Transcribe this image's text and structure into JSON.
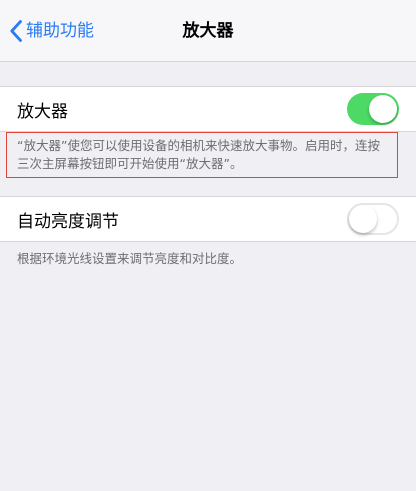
{
  "navbar": {
    "back_label": "辅助功能",
    "title": "放大器",
    "accent": "#2a7bf6"
  },
  "magnifier": {
    "label": "放大器",
    "switch_on": true,
    "footer": "“放大器”使您可以使用设备的相机来快速放大事物。启用时，连按三次主屏幕按钮即可开始使用“放大器”。"
  },
  "auto_brightness": {
    "label": "自动亮度调节",
    "switch_on": false,
    "footer": "根据环境光线设置来调节亮度和对比度。"
  },
  "colors": {
    "switch_on": "#4cd964",
    "highlight_border": "#e0463c"
  },
  "icons": {
    "back": "chevron-left-icon"
  }
}
